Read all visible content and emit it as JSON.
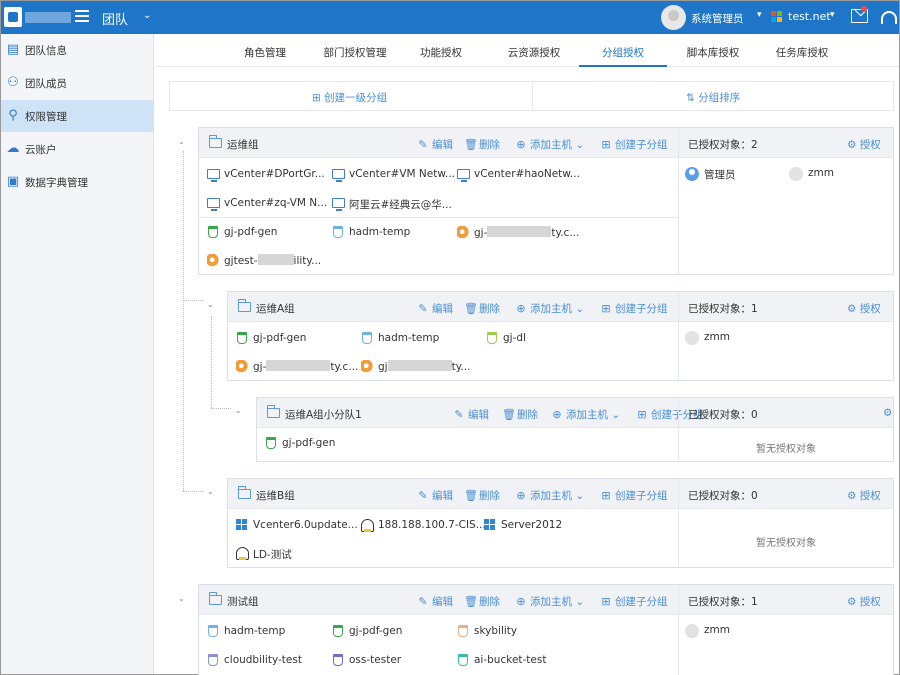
{
  "header": {
    "team_label": "团队",
    "user_name": "系统管理员",
    "tenant": "test.net"
  },
  "sidebar": {
    "items": [
      {
        "label": "团队信息",
        "icon": "document-icon"
      },
      {
        "label": "团队成员",
        "icon": "users-icon"
      },
      {
        "label": "权限管理",
        "icon": "user-key-icon",
        "active": true
      },
      {
        "label": "云账户",
        "icon": "cloud-icon"
      },
      {
        "label": "数据字典管理",
        "icon": "book-icon"
      }
    ]
  },
  "tabs": [
    {
      "label": "角色管理"
    },
    {
      "label": "部门授权管理"
    },
    {
      "label": "功能授权"
    },
    {
      "label": "云资源授权"
    },
    {
      "label": "分组授权",
      "active": true
    },
    {
      "label": "脚本库授权"
    },
    {
      "label": "任务库授权"
    }
  ],
  "actions": {
    "create_top_group": "创建一级分组",
    "sort_groups": "分组排序"
  },
  "ops": {
    "edit": "编辑",
    "delete": "删除",
    "add_host": "添加主机",
    "create_subgroup": "创建子分组",
    "authorize": "授权",
    "no_auth": "暂无授权对象"
  },
  "groups": [
    {
      "name": "运维组",
      "auth_label": "已授权对象：2",
      "hosts": [
        "vCenter#DPortGr...",
        "vCenter#VM Netw...",
        "vCenter#haoNetw...",
        "vCenter#zq-VM N...",
        "阿里云#经典云@华..."
      ],
      "resources": [
        {
          "type": "bucket",
          "color": "#36a84a",
          "label": "gj-pdf-gen"
        },
        {
          "type": "bucket",
          "color": "#6fb3e4",
          "label": "hadm-temp"
        },
        {
          "type": "cloud",
          "label_pre": "gj-",
          "label_post": "ty.c..."
        },
        {
          "type": "cloud",
          "label_pre": "gjtest-",
          "label_post": "ility..."
        }
      ],
      "members": [
        {
          "name": "管理员",
          "admin": true
        },
        {
          "name": "zmm"
        }
      ]
    },
    {
      "name": "运维A组",
      "auth_label": "已授权对象：1",
      "resources": [
        {
          "type": "bucket",
          "color": "#36a84a",
          "label": "gj-pdf-gen"
        },
        {
          "type": "bucket",
          "color": "#6fb3e4",
          "label": "hadm-temp"
        },
        {
          "type": "bucket",
          "color": "#9ccd4f",
          "label": "gj-dl"
        },
        {
          "type": "cloud",
          "label_pre": "gj-",
          "label_post": "ty.c..."
        },
        {
          "type": "cloud",
          "label_pre": "gj",
          "label_post": "ty..."
        }
      ],
      "members": [
        {
          "name": "zmm"
        }
      ]
    },
    {
      "name": "运维A组小分队1",
      "auth_label": "已授权对象：0",
      "resources": [
        {
          "type": "bucket",
          "color": "#36a84a",
          "label": "gj-pdf-gen"
        }
      ],
      "members": []
    },
    {
      "name": "运维B组",
      "auth_label": "已授权对象：0",
      "resources": [
        {
          "type": "win",
          "label": "Vcenter6.0update..."
        },
        {
          "type": "linux",
          "label": "188.188.100.7-CIS..."
        },
        {
          "type": "win",
          "label": "Server2012"
        },
        {
          "type": "linux",
          "label": "LD-测试"
        }
      ],
      "members": []
    },
    {
      "name": "测试组",
      "auth_label": "已授权对象：1",
      "resources": [
        {
          "type": "bucket",
          "color": "#6fb3e4",
          "label": "hadm-temp"
        },
        {
          "type": "bucket",
          "color": "#36a84a",
          "label": "gj-pdf-gen"
        },
        {
          "type": "bucket",
          "color": "#e6b08a",
          "label": "skybility"
        },
        {
          "type": "bucket",
          "color": "#8b8fd8",
          "label": "cloudbility-test"
        },
        {
          "type": "bucket",
          "color": "#6b6fd0",
          "label": "oss-tester"
        },
        {
          "type": "bucket",
          "color": "#2fbdb5",
          "label": "ai-bucket-test"
        }
      ],
      "members": [
        {
          "name": "zmm"
        }
      ]
    }
  ]
}
